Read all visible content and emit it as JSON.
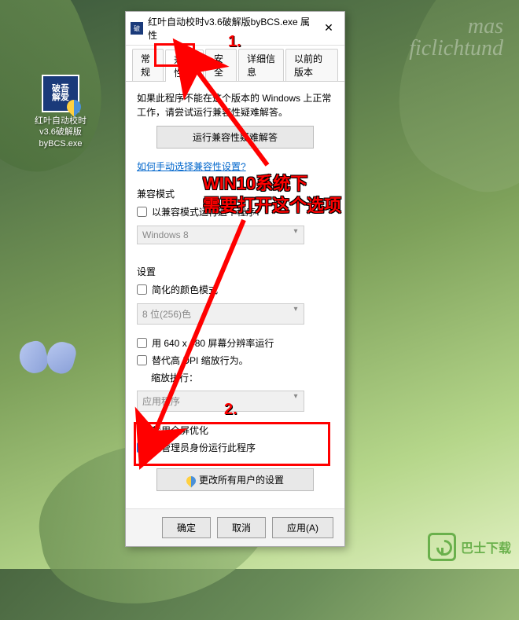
{
  "desktop": {
    "icon_label": "红叶自动校时v3.6破解版byBCS.exe",
    "icon_text": "破吾\n解爱"
  },
  "watermark_top": "mas\nficlichtund",
  "watermark_bottom": "巴士下载",
  "dialog": {
    "title": "红叶自动校时v3.6破解版byBCS.exe 属性",
    "tabs": [
      "常规",
      "兼容性",
      "安全",
      "详细信息",
      "以前的版本"
    ],
    "active_tab": 1,
    "info_text": "如果此程序不能在这个版本的 Windows 上正常工作，请尝试运行兼容性疑难解答。",
    "troubleshoot_btn": "运行兼容性疑难解答",
    "manual_link": "如何手动选择兼容性设置?",
    "compat_mode": {
      "label": "兼容模式",
      "checkbox": "以兼容模式运行这个程序：",
      "select": "Windows 8"
    },
    "settings": {
      "label": "设置",
      "reduced_color": "简化的颜色模式",
      "color_select": "8 位(256)色",
      "low_res": "用 640 x 480 屏幕分辨率运行",
      "dpi_label": "替代高 DPI 缩放行为。",
      "dpi_sublabel": "缩放执行：",
      "dpi_select": "应用程序",
      "fullscreen_opt": "禁用全屏优化",
      "run_as_admin": "以管理员身份运行此程序"
    },
    "change_all_btn": "更改所有用户的设置",
    "ok": "确定",
    "cancel": "取消",
    "apply": "应用(A)"
  },
  "annotations": {
    "num1": "1.",
    "num2": "2.",
    "line1": "WIN10系统下",
    "line2": "需要打开这个选项"
  }
}
